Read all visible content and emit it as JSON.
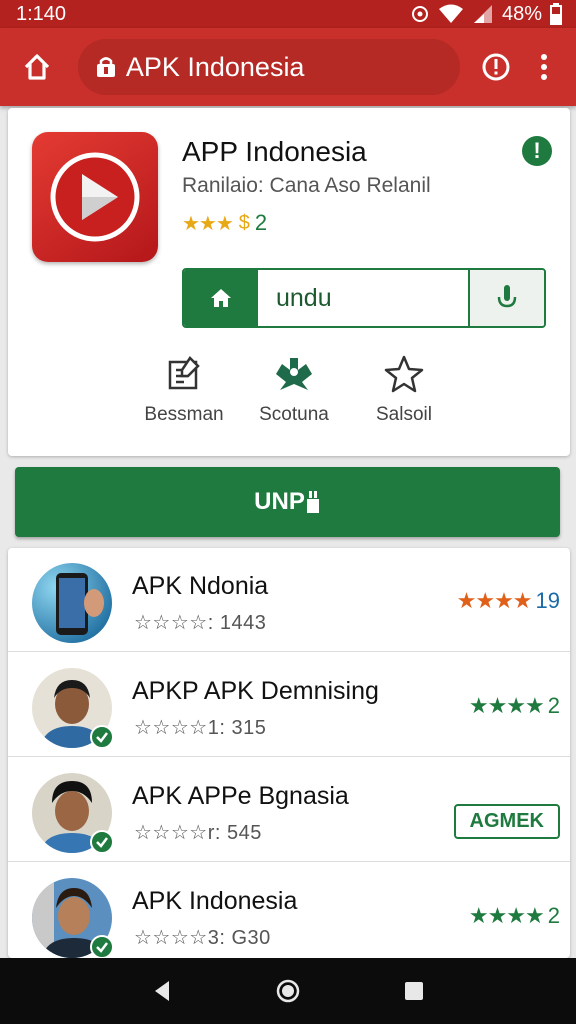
{
  "status": {
    "time": "1:140",
    "battery": "48%"
  },
  "toolbar": {
    "url_text": "APK Indonesia"
  },
  "app": {
    "title": "APP Indonesia",
    "subtitle": "Ranilaio: Cana Aso Relanil",
    "rating_stars": "★★★",
    "rating_extra": "$",
    "rating_value": "2",
    "info_mark": "!"
  },
  "download": {
    "text": "undu"
  },
  "actions": [
    {
      "label": "Bessman",
      "icon": "edit-icon"
    },
    {
      "label": "Scotuna",
      "icon": "share-icon"
    },
    {
      "label": "Salsoil",
      "icon": "star-outline-icon"
    }
  ],
  "primary_button": {
    "label": "UNP"
  },
  "list": [
    {
      "title": "APK Ndonia",
      "subtitle": "☆☆☆☆: 1443",
      "stars": "★★★★",
      "count": "19",
      "badge": "",
      "verified": false
    },
    {
      "title": "APKP APK Demnising",
      "subtitle": "☆☆☆☆1: 315",
      "stars": "★★★★",
      "count": "2",
      "badge": "",
      "verified": true
    },
    {
      "title": "APK APPe Bgnasia",
      "subtitle": "☆☆☆☆r: 545",
      "stars": "",
      "count": "",
      "badge": "AGMEK",
      "verified": true
    },
    {
      "title": "APK Indonesia",
      "subtitle": "☆☆☆☆3: G30",
      "stars": "★★★★",
      "count": "2",
      "badge": "",
      "verified": true
    }
  ],
  "colors": {
    "brand_red": "#c9302b",
    "status_red": "#b3221f",
    "primary_green": "#1e7a3e",
    "star_gold": "#e8a916",
    "star_orange": "#e0601a"
  }
}
